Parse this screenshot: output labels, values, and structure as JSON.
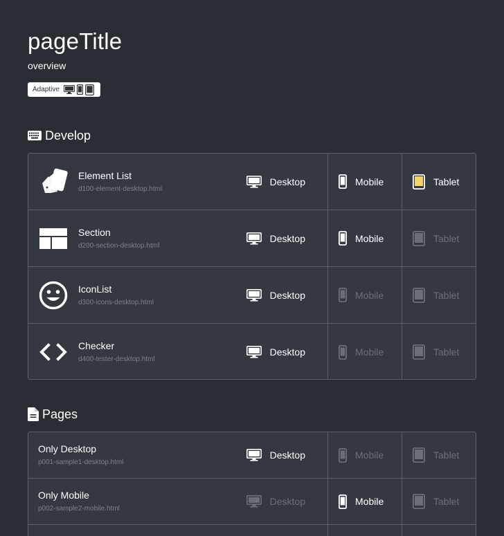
{
  "header": {
    "title": "pageTitle",
    "overview": "overview",
    "badge_label": "Adaptive"
  },
  "sections": {
    "develop": {
      "title": "Develop",
      "icon": "keyboard-icon",
      "rows": [
        {
          "name": "Element List",
          "file": "d100-element-desktop.html",
          "icon": "cards-icon",
          "desktop": "Desktop",
          "mobile": "Mobile",
          "tablet": "Tablet",
          "desktop_on": true,
          "mobile_on": true,
          "tablet_on": true
        },
        {
          "name": "Section",
          "file": "d200-section-desktop.html",
          "icon": "layout-icon",
          "desktop": "Desktop",
          "mobile": "Mobile",
          "tablet": "Tablet",
          "desktop_on": true,
          "mobile_on": true,
          "tablet_on": false
        },
        {
          "name": "IconList",
          "file": "d300-icons-desktop.html",
          "icon": "smiley-icon",
          "desktop": "Desktop",
          "mobile": "Mobile",
          "tablet": "Tablet",
          "desktop_on": true,
          "mobile_on": false,
          "tablet_on": false
        },
        {
          "name": "Checker",
          "file": "d400-tester-desktop.html",
          "icon": "code-icon",
          "desktop": "Desktop",
          "mobile": "Mobile",
          "tablet": "Tablet",
          "desktop_on": true,
          "mobile_on": false,
          "tablet_on": false
        }
      ]
    },
    "pages": {
      "title": "Pages",
      "icon": "document-icon",
      "rows": [
        {
          "name": "Only Desktop",
          "file": "p001-sample1-desktop.html",
          "desktop": "Desktop",
          "mobile": "Mobile",
          "tablet": "Tablet",
          "desktop_on": true,
          "mobile_on": false,
          "tablet_on": false
        },
        {
          "name": "Only Mobile",
          "file": "p002-sample2-mobile.html",
          "desktop": "Desktop",
          "mobile": "Mobile",
          "tablet": "Tablet",
          "desktop_on": false,
          "mobile_on": true,
          "tablet_on": false
        }
      ]
    }
  },
  "colors": {
    "background": "#2a2d33",
    "card": "#343840",
    "border": "#5b5f66",
    "active": "#ffffff",
    "inactive": "#6b6f77",
    "tablet_active_screen": "#f3d36b"
  }
}
